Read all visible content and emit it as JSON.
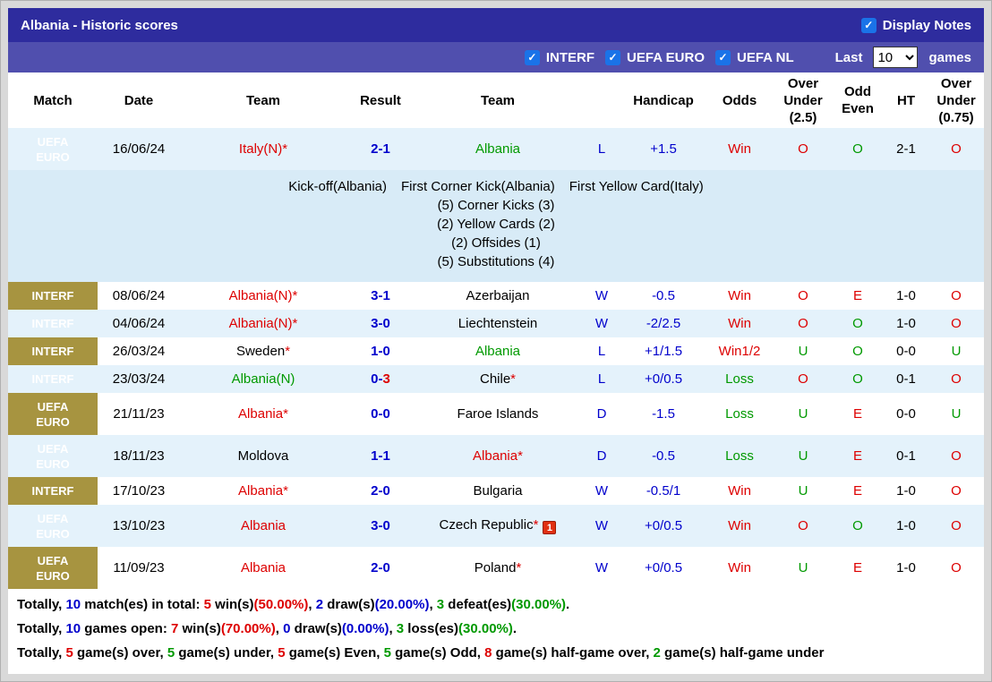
{
  "header": {
    "title": "Albania - Historic scores",
    "display_notes_label": "Display Notes"
  },
  "filters": {
    "competitions": [
      {
        "label": "INTERF",
        "checked": true
      },
      {
        "label": "UEFA EURO",
        "checked": true
      },
      {
        "label": "UEFA NL",
        "checked": true
      }
    ],
    "last_label": "Last",
    "games_count": "10",
    "games_label": "games"
  },
  "colors": {
    "navy": "#2e2c9e",
    "purple": "#504fae",
    "gold": "#a79440",
    "accent": "#1a73e8",
    "red": "#dd0000",
    "green": "#009900",
    "blue": "#0000cc",
    "shade": "#e4f2fb",
    "notes_bg": "#d8ebf7"
  },
  "table": {
    "columns": [
      "Match",
      "Date",
      "Team",
      "Result",
      "Team",
      "",
      "Handicap",
      "Odds",
      "Over Under (2.5)",
      "Odd Even",
      "HT",
      "Over Under (0.75)"
    ],
    "rows": [
      {
        "league": [
          "UEFA",
          "EURO"
        ],
        "date": "16/06/24",
        "team1": {
          "name": "Italy(N)",
          "color": "red",
          "star": true
        },
        "result": [
          {
            "t": "2-1",
            "c": "blue"
          }
        ],
        "team2": {
          "name": "Albania",
          "color": "green",
          "star": false
        },
        "wld": "L",
        "handicap": "+1.5",
        "odds": {
          "t": "Win",
          "c": "red"
        },
        "ou25": {
          "t": "O",
          "c": "red"
        },
        "oddeven": {
          "t": "O",
          "c": "green"
        },
        "ht": "2-1",
        "ou075": {
          "t": "O",
          "c": "red"
        },
        "shade": true,
        "notes": {
          "header": [
            "Kick-off(Albania)",
            "First Corner Kick(Albania)",
            "First Yellow Card(Italy)"
          ],
          "lines": [
            "(5) Corner Kicks (3)",
            "(2) Yellow Cards (2)",
            "(2) Offsides (1)",
            "(5) Substitutions (4)"
          ]
        }
      },
      {
        "league": [
          "INTERF"
        ],
        "date": "08/06/24",
        "team1": {
          "name": "Albania(N)",
          "color": "red",
          "star": true
        },
        "result": [
          {
            "t": "3-1",
            "c": "blue"
          }
        ],
        "team2": {
          "name": "Azerbaijan",
          "color": "black",
          "star": false
        },
        "wld": "W",
        "handicap": "-0.5",
        "odds": {
          "t": "Win",
          "c": "red"
        },
        "ou25": {
          "t": "O",
          "c": "red"
        },
        "oddeven": {
          "t": "E",
          "c": "red"
        },
        "ht": "1-0",
        "ou075": {
          "t": "O",
          "c": "red"
        },
        "shade": false
      },
      {
        "league": [
          "INTERF"
        ],
        "date": "04/06/24",
        "team1": {
          "name": "Albania(N)",
          "color": "red",
          "star": true
        },
        "result": [
          {
            "t": "3-0",
            "c": "blue"
          }
        ],
        "team2": {
          "name": "Liechtenstein",
          "color": "black",
          "star": false
        },
        "wld": "W",
        "handicap": "-2/2.5",
        "odds": {
          "t": "Win",
          "c": "red"
        },
        "ou25": {
          "t": "O",
          "c": "red"
        },
        "oddeven": {
          "t": "O",
          "c": "green"
        },
        "ht": "1-0",
        "ou075": {
          "t": "O",
          "c": "red"
        },
        "shade": true
      },
      {
        "league": [
          "INTERF"
        ],
        "date": "26/03/24",
        "team1": {
          "name": "Sweden",
          "color": "black",
          "star": true
        },
        "result": [
          {
            "t": "1-0",
            "c": "blue"
          }
        ],
        "team2": {
          "name": "Albania",
          "color": "green",
          "star": false
        },
        "wld": "L",
        "handicap": "+1/1.5",
        "odds": {
          "t": "Win1/2",
          "c": "red"
        },
        "ou25": {
          "t": "U",
          "c": "green"
        },
        "oddeven": {
          "t": "O",
          "c": "green"
        },
        "ht": "0-0",
        "ou075": {
          "t": "U",
          "c": "green"
        },
        "shade": false
      },
      {
        "league": [
          "INTERF"
        ],
        "date": "23/03/24",
        "team1": {
          "name": "Albania(N)",
          "color": "green",
          "star": false
        },
        "result": [
          {
            "t": "0-",
            "c": "blue"
          },
          {
            "t": "3",
            "c": "red"
          }
        ],
        "team2": {
          "name": "Chile",
          "color": "black",
          "star": true
        },
        "wld": "L",
        "handicap": "+0/0.5",
        "odds": {
          "t": "Loss",
          "c": "green"
        },
        "ou25": {
          "t": "O",
          "c": "red"
        },
        "oddeven": {
          "t": "O",
          "c": "green"
        },
        "ht": "0-1",
        "ou075": {
          "t": "O",
          "c": "red"
        },
        "shade": true
      },
      {
        "league": [
          "UEFA",
          "EURO"
        ],
        "date": "21/11/23",
        "team1": {
          "name": "Albania",
          "color": "red",
          "star": true
        },
        "result": [
          {
            "t": "0-0",
            "c": "blue"
          }
        ],
        "team2": {
          "name": "Faroe Islands",
          "color": "black",
          "star": false
        },
        "wld": "D",
        "handicap": "-1.5",
        "odds": {
          "t": "Loss",
          "c": "green"
        },
        "ou25": {
          "t": "U",
          "c": "green"
        },
        "oddeven": {
          "t": "E",
          "c": "red"
        },
        "ht": "0-0",
        "ou075": {
          "t": "U",
          "c": "green"
        },
        "shade": false
      },
      {
        "league": [
          "UEFA",
          "EURO"
        ],
        "date": "18/11/23",
        "team1": {
          "name": "Moldova",
          "color": "black",
          "star": false
        },
        "result": [
          {
            "t": "1-1",
            "c": "blue"
          }
        ],
        "team2": {
          "name": "Albania",
          "color": "red",
          "star": true
        },
        "wld": "D",
        "handicap": "-0.5",
        "odds": {
          "t": "Loss",
          "c": "green"
        },
        "ou25": {
          "t": "U",
          "c": "green"
        },
        "oddeven": {
          "t": "E",
          "c": "red"
        },
        "ht": "0-1",
        "ou075": {
          "t": "O",
          "c": "red"
        },
        "shade": true
      },
      {
        "league": [
          "INTERF"
        ],
        "date": "17/10/23",
        "team1": {
          "name": "Albania",
          "color": "red",
          "star": true
        },
        "result": [
          {
            "t": "2-0",
            "c": "blue"
          }
        ],
        "team2": {
          "name": "Bulgaria",
          "color": "black",
          "star": false
        },
        "wld": "W",
        "handicap": "-0.5/1",
        "odds": {
          "t": "Win",
          "c": "red"
        },
        "ou25": {
          "t": "U",
          "c": "green"
        },
        "oddeven": {
          "t": "E",
          "c": "red"
        },
        "ht": "1-0",
        "ou075": {
          "t": "O",
          "c": "red"
        },
        "shade": false
      },
      {
        "league": [
          "UEFA",
          "EURO"
        ],
        "date": "13/10/23",
        "team1": {
          "name": "Albania",
          "color": "red",
          "star": false
        },
        "result": [
          {
            "t": "3-0",
            "c": "blue"
          }
        ],
        "team2": {
          "name": "Czech Republic",
          "color": "black",
          "star": true,
          "icon": "1"
        },
        "wld": "W",
        "handicap": "+0/0.5",
        "odds": {
          "t": "Win",
          "c": "red"
        },
        "ou25": {
          "t": "O",
          "c": "red"
        },
        "oddeven": {
          "t": "O",
          "c": "green"
        },
        "ht": "1-0",
        "ou075": {
          "t": "O",
          "c": "red"
        },
        "shade": true
      },
      {
        "league": [
          "UEFA",
          "EURO"
        ],
        "date": "11/09/23",
        "team1": {
          "name": "Albania",
          "color": "red",
          "star": false
        },
        "result": [
          {
            "t": "2-0",
            "c": "blue"
          }
        ],
        "team2": {
          "name": "Poland",
          "color": "black",
          "star": true
        },
        "wld": "W",
        "handicap": "+0/0.5",
        "odds": {
          "t": "Win",
          "c": "red"
        },
        "ou25": {
          "t": "U",
          "c": "green"
        },
        "oddeven": {
          "t": "E",
          "c": "red"
        },
        "ht": "1-0",
        "ou075": {
          "t": "O",
          "c": "red"
        },
        "shade": false
      }
    ]
  },
  "footer": {
    "lines": [
      [
        {
          "t": "Totally, "
        },
        {
          "t": "10",
          "c": "blue"
        },
        {
          "t": " match(es) in total: "
        },
        {
          "t": "5",
          "c": "red"
        },
        {
          "t": " win(s)"
        },
        {
          "t": "(50.00%)",
          "c": "red"
        },
        {
          "t": ", "
        },
        {
          "t": "2",
          "c": "blue"
        },
        {
          "t": " draw(s)"
        },
        {
          "t": "(20.00%)",
          "c": "blue"
        },
        {
          "t": ", "
        },
        {
          "t": "3",
          "c": "green"
        },
        {
          "t": " defeat(es)"
        },
        {
          "t": "(30.00%)",
          "c": "green"
        },
        {
          "t": "."
        }
      ],
      [
        {
          "t": "Totally, "
        },
        {
          "t": "10",
          "c": "blue"
        },
        {
          "t": " games open: "
        },
        {
          "t": "7",
          "c": "red"
        },
        {
          "t": " win(s)"
        },
        {
          "t": "(70.00%)",
          "c": "red"
        },
        {
          "t": ", "
        },
        {
          "t": "0",
          "c": "blue"
        },
        {
          "t": " draw(s)"
        },
        {
          "t": "(0.00%)",
          "c": "blue"
        },
        {
          "t": ", "
        },
        {
          "t": "3",
          "c": "green"
        },
        {
          "t": " loss(es)"
        },
        {
          "t": "(30.00%)",
          "c": "green"
        },
        {
          "t": "."
        }
      ],
      [
        {
          "t": "Totally, "
        },
        {
          "t": "5",
          "c": "red"
        },
        {
          "t": " game(s) over, "
        },
        {
          "t": "5",
          "c": "green"
        },
        {
          "t": " game(s) under, "
        },
        {
          "t": "5",
          "c": "red"
        },
        {
          "t": " game(s) Even, "
        },
        {
          "t": "5",
          "c": "green"
        },
        {
          "t": " game(s) Odd, "
        },
        {
          "t": "8",
          "c": "red"
        },
        {
          "t": " game(s) half-game over, "
        },
        {
          "t": "2",
          "c": "green"
        },
        {
          "t": " game(s) half-game under"
        }
      ]
    ]
  }
}
